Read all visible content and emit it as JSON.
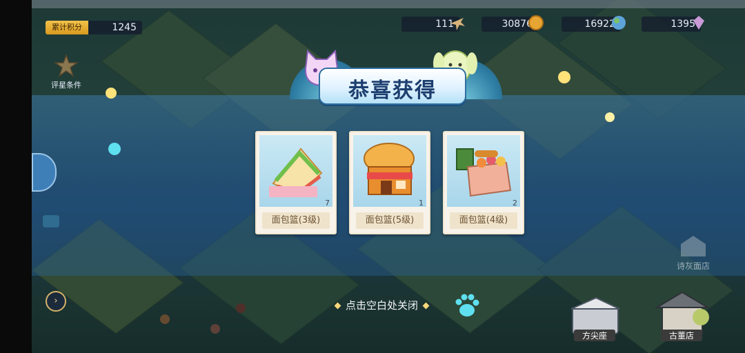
{
  "hud": {
    "score_label": "累计积分",
    "score_value": "1245",
    "resources": [
      {
        "value": "111",
        "icon": "plane-icon"
      },
      {
        "value": "30876",
        "icon": "coin-icon"
      },
      {
        "value": "16922",
        "icon": "globe-icon"
      },
      {
        "value": "1395",
        "icon": "gem-icon"
      }
    ],
    "rating_label": "评星条件"
  },
  "popup": {
    "title": "恭喜获得",
    "rewards": [
      {
        "name": "面包篮(3级)",
        "quantity": "7",
        "icon": "sandwich-icon"
      },
      {
        "name": "面包篮(5级)",
        "quantity": "1",
        "icon": "bakery-icon"
      },
      {
        "name": "面包篮(4级)",
        "quantity": "2",
        "icon": "bread-stall-icon"
      }
    ],
    "close_hint": "点击空白处关闭"
  },
  "buildings": {
    "left_shop": "诗灰面店",
    "bottom_shop_1": "方尖座",
    "bottom_shop_2": "古董店"
  },
  "colors": {
    "title_text": "#1d3f6f",
    "card_bg": "#f8f3ea",
    "name_text": "#6b5232",
    "hint_text": "#f3f6fb"
  }
}
